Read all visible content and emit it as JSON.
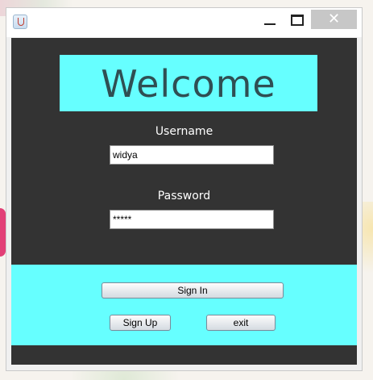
{
  "window": {
    "minimize_icon": "minimize-icon",
    "maximize_icon": "maximize-icon",
    "close_symbol": "✕"
  },
  "banner": {
    "welcome_text": "Welcome",
    "background": "#66ffff"
  },
  "form": {
    "username_label": "Username",
    "username_value": "widya",
    "password_label": "Password",
    "password_value": "*****"
  },
  "buttons": {
    "sign_in": "Sign In",
    "sign_up": "Sign Up",
    "exit": "exit"
  },
  "colors": {
    "dark_panel": "#333333",
    "accent_cyan": "#66ffff",
    "welcome_text": "#2f4f53"
  }
}
